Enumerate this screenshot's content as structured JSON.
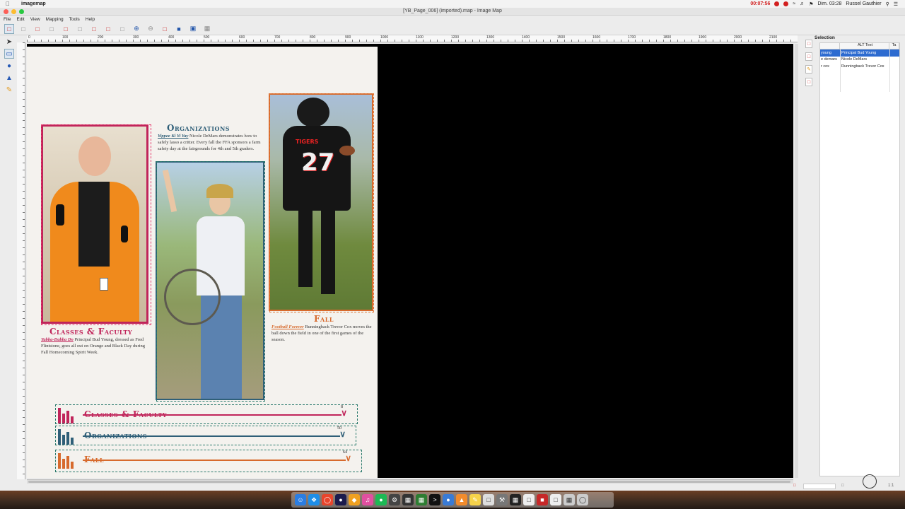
{
  "menubar": {
    "app_name": "imagemap",
    "recording_time": "00:07:56",
    "clock": "Dim. 03:28",
    "user": "Russel Gauthier"
  },
  "window": {
    "title": "[YB_Page_006] (imported).map - Image Map"
  },
  "app_menu": [
    "File",
    "Edit",
    "View",
    "Mapping",
    "Tools",
    "Help"
  ],
  "ruler": {
    "ticks": [
      "0",
      "100",
      "200",
      "300",
      "400",
      "500",
      "600",
      "700",
      "800",
      "900",
      "1000",
      "1100",
      "1200",
      "1300",
      "1400",
      "1500",
      "1600",
      "1700",
      "1800",
      "1900",
      "2000",
      "2100"
    ]
  },
  "page": {
    "classes": {
      "heading": "Classes & Faculty",
      "lead": "Yabba-Dabba Do",
      "text": " Principal Bud Young, dressed as Fred Flintstone, goes all out on Orange and Black Day during Fall Homecoming Spirit Week."
    },
    "organizations": {
      "heading": "Organizations",
      "lead": "Yippee Ki Yi Yay",
      "text": " Nicole DeMars demonstrates how to safely lasso a critter. Every fall the FFA sponsors a farm safety day at the fairgrounds for 4th and 5th graders."
    },
    "fall": {
      "heading": "Fall",
      "lead": "Football Forever",
      "text": " Runningback Trevor Cox moves the ball down the field in one of the first games of the season."
    },
    "jersey_text": "TIGERS",
    "jersey_number": "27",
    "nav": [
      {
        "label": "Classes & Faculty",
        "page": "8",
        "color": "#c0245a"
      },
      {
        "label": "Organizations",
        "page": "50",
        "color": "#2f5f78"
      },
      {
        "label": "Fall",
        "page": "64",
        "color": "#d76a2d"
      }
    ]
  },
  "selection_panel": {
    "title": "Selection",
    "columns": [
      "",
      "ALT Text",
      "Ta"
    ],
    "rows": [
      {
        "url": "young",
        "alt": "Principal Bud Young",
        "selected": true
      },
      {
        "url": "e demars",
        "alt": "Nicole DeMars",
        "selected": false
      },
      {
        "url": "r cox",
        "alt": "Runningback Trevor Cox",
        "selected": false
      }
    ]
  },
  "status": {
    "zoom": "1:1"
  },
  "colors": {
    "classes": "#c0245a",
    "organizations": "#2f5f78",
    "fall": "#d76a2d",
    "selection_highlight": "#2d6bd0"
  }
}
